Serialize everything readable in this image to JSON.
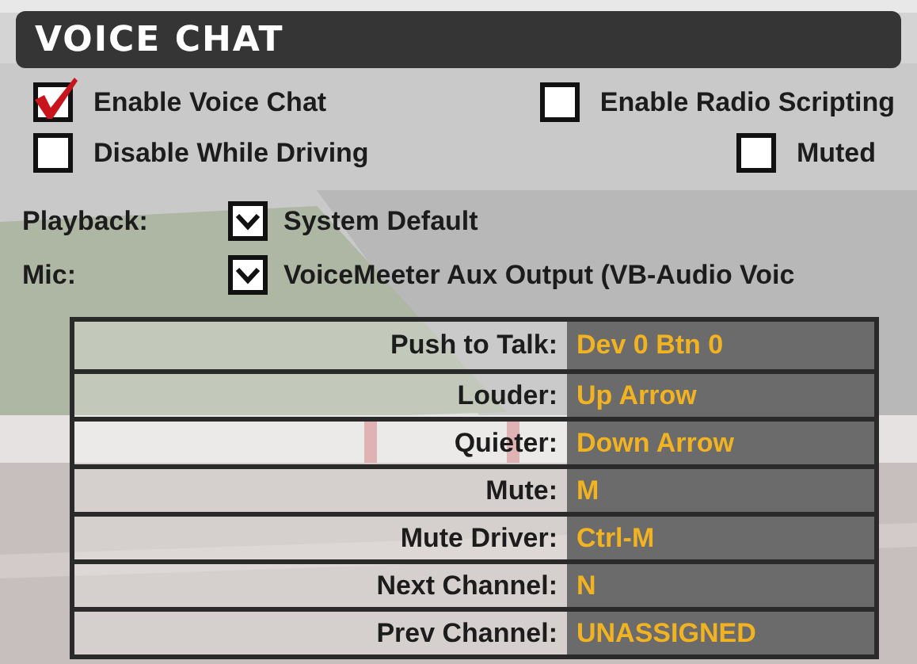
{
  "title": "VOICE CHAT",
  "options": [
    {
      "label": "Enable Voice Chat",
      "checked": true
    },
    {
      "label": "Enable Radio Scripting",
      "checked": false
    },
    {
      "label": "Disable While Driving",
      "checked": false
    },
    {
      "label": "Muted",
      "checked": false
    }
  ],
  "devices": [
    {
      "label": "Playback:",
      "value": "System Default"
    },
    {
      "label": "Mic:",
      "value": "VoiceMeeter Aux Output (VB-Audio Voic"
    }
  ],
  "bindings": [
    {
      "action": "Push to Talk:",
      "key": "Dev 0 Btn 0"
    },
    {
      "action": "Louder:",
      "key": "Up Arrow"
    },
    {
      "action": "Quieter:",
      "key": "Down Arrow"
    },
    {
      "action": "Mute:",
      "key": "M"
    },
    {
      "action": "Mute Driver:",
      "key": "Ctrl-M"
    },
    {
      "action": "Next Channel:",
      "key": "N"
    },
    {
      "action": "Prev Channel:",
      "key": "UNASSIGNED"
    }
  ]
}
